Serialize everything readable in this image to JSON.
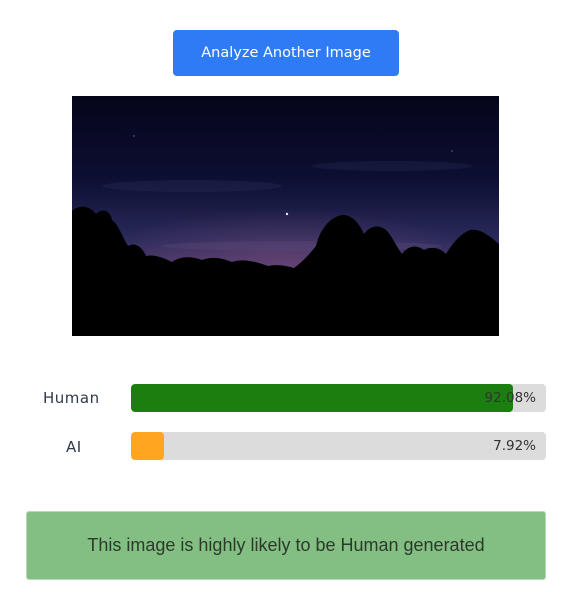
{
  "actions": {
    "analyze_label": "Analyze Another Image"
  },
  "image": {
    "subject": "night sky over silhouetted trees at dusk"
  },
  "results": [
    {
      "label": "Human",
      "value_text": "92.08%",
      "fraction": 0.9208,
      "color": "#1a7f0f"
    },
    {
      "label": "AI",
      "value_text": "7.92%",
      "fraction": 0.0792,
      "color": "#ffa51f"
    }
  ],
  "verdict": {
    "text": "This image is highly likely to be Human generated",
    "color": "#83be83"
  }
}
